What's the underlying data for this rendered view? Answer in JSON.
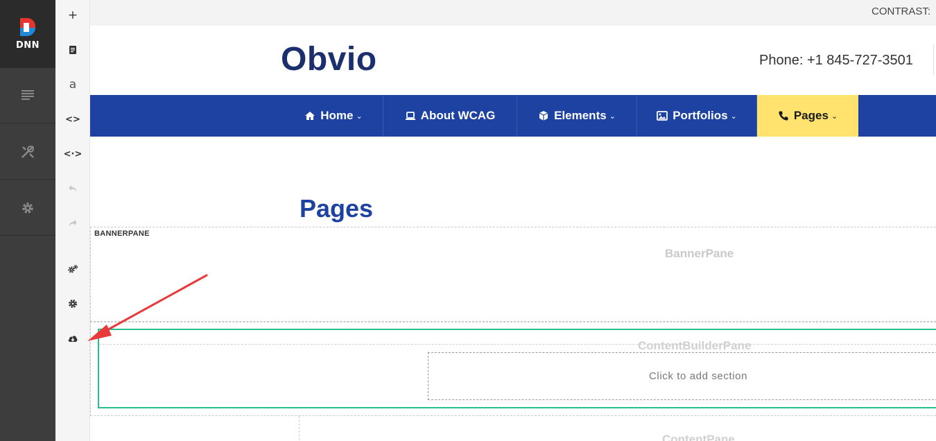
{
  "persona_bar": {
    "logo_text": "DNN",
    "items": [
      {
        "icon": "content-icon"
      },
      {
        "icon": "tools-icon"
      },
      {
        "icon": "settings-icon"
      }
    ]
  },
  "edit_toolbar": {
    "buttons": [
      {
        "icon": "plus-icon",
        "glyph": "+"
      },
      {
        "icon": "document-icon"
      },
      {
        "icon": "text-icon",
        "glyph": "a"
      },
      {
        "icon": "code-icon",
        "glyph": "<>"
      },
      {
        "icon": "expand-code-icon",
        "glyph": "<·>"
      },
      {
        "icon": "undo-icon"
      },
      {
        "icon": "redo-icon"
      },
      {
        "icon": "cogs-icon"
      },
      {
        "icon": "gear-icon"
      },
      {
        "icon": "cloud-download-icon"
      }
    ]
  },
  "top_bar": {
    "contrast_label": "CONTRAST:"
  },
  "header": {
    "logo": "Obvio",
    "phone": "Phone: +1 845-727-3501"
  },
  "nav": {
    "items": [
      {
        "label": "Home",
        "icon": "home-icon",
        "dropdown": true
      },
      {
        "label": "About WCAG",
        "icon": "laptop-icon",
        "dropdown": false
      },
      {
        "label": "Elements",
        "icon": "cube-icon",
        "dropdown": true
      },
      {
        "label": "Portfolios",
        "icon": "image-icon",
        "dropdown": true
      },
      {
        "label": "Pages",
        "icon": "phone-icon",
        "dropdown": true,
        "active": true
      }
    ],
    "active_color": "#ffe36e",
    "bar_color": "#1d42a1",
    "chevron": "⌄"
  },
  "page": {
    "title": "Pages"
  },
  "panes": {
    "banner_tag": "BANNERPANE",
    "banner_name": "BannerPane",
    "content_builder_name": "ContentBuilderPane",
    "add_section": "Click to add section",
    "content_name": "ContentPane"
  },
  "annotation": {
    "arrow_color": "#e83a3a",
    "target": "cloud-download-icon"
  }
}
